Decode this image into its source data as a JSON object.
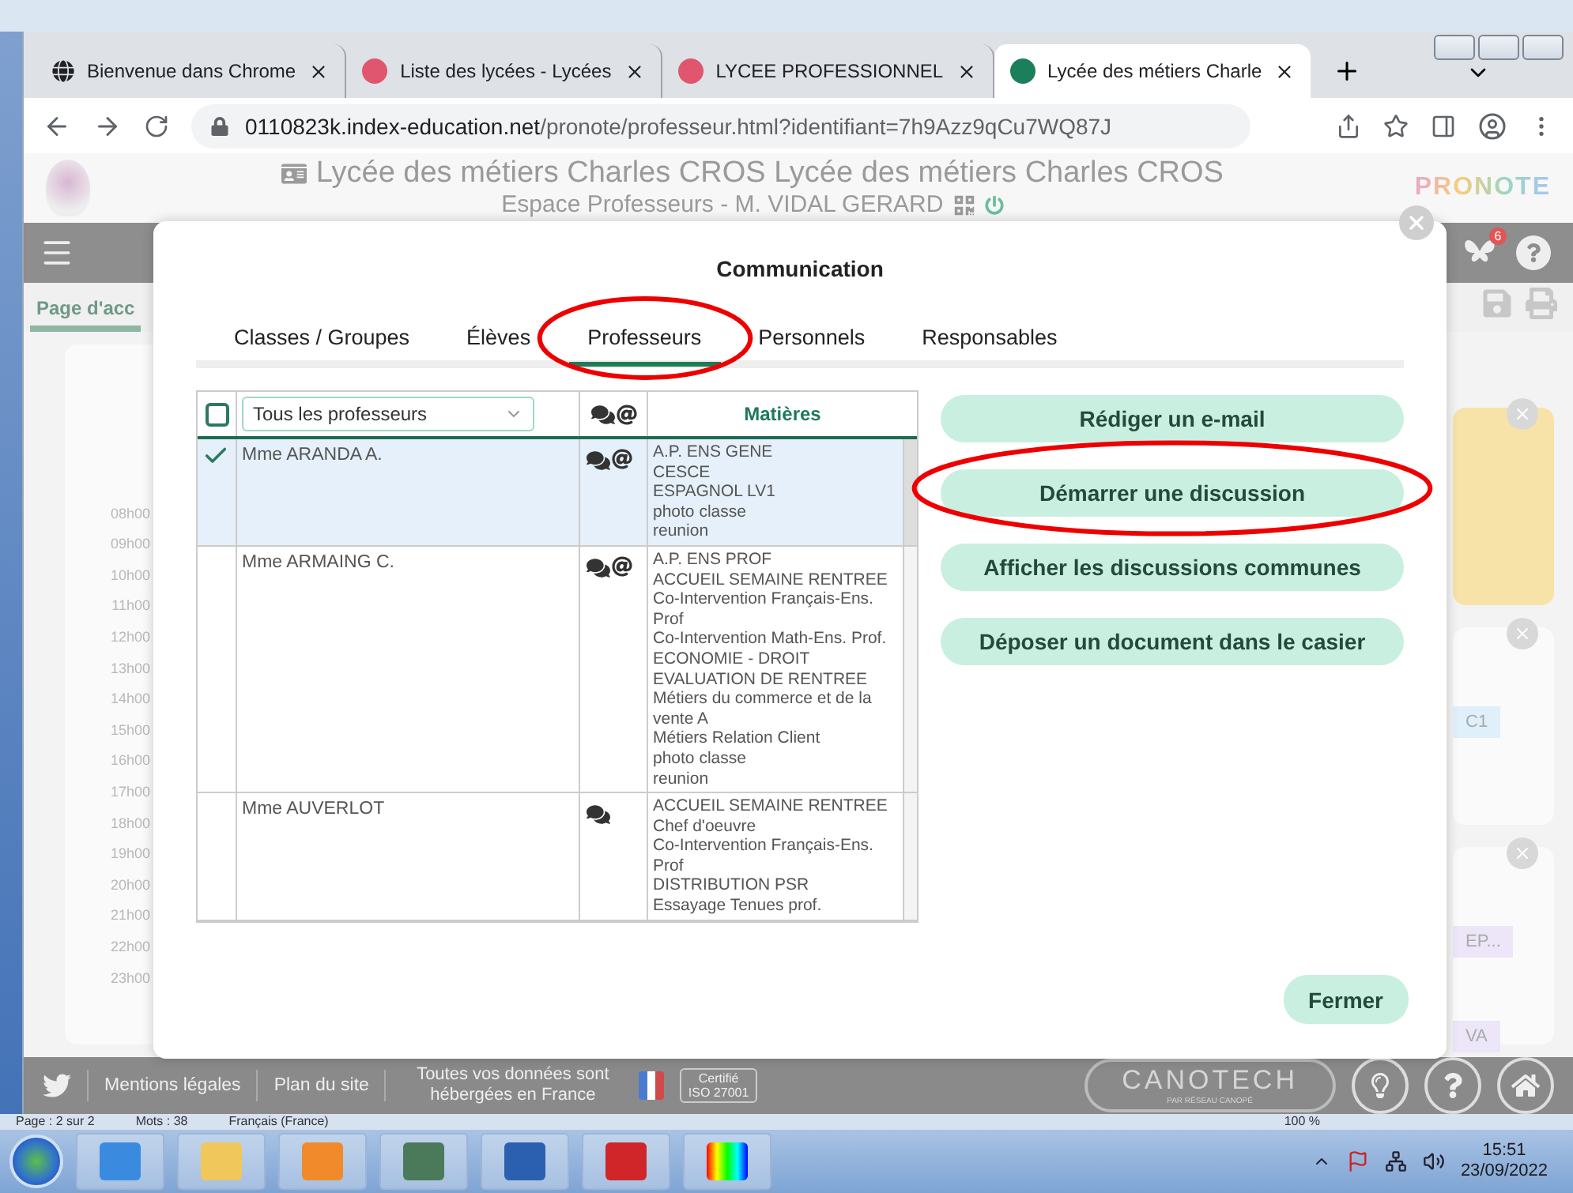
{
  "browser": {
    "tabs": [
      {
        "title": "Bienvenue dans Chrome",
        "selected": false
      },
      {
        "title": "Liste des lycées - Lycées",
        "selected": false
      },
      {
        "title": "LYCEE PROFESSIONNEL",
        "selected": false
      },
      {
        "title": "Lycée des métiers Charle",
        "selected": true
      }
    ],
    "url": {
      "host": "0110823k.index-education.net",
      "path": "/pronote/professeur.html?identifiant=7h9Azz9qCu7WQ87J"
    }
  },
  "header": {
    "title": "Lycée des métiers Charles CROS Lycée des métiers Charles CROS",
    "subtitle": "Espace Professeurs - M. VIDAL GERARD",
    "brand": "PRONOTE",
    "notification_count": "6"
  },
  "page": {
    "tab": "Page d'acc",
    "hours": [
      "08h00",
      "09h00",
      "10h00",
      "11h00",
      "12h00",
      "13h00",
      "14h00",
      "15h00",
      "16h00",
      "17h00",
      "18h00",
      "19h00",
      "20h00",
      "21h00",
      "22h00",
      "23h00"
    ],
    "tags": [
      {
        "text": "C1",
        "color": "#dff0fb"
      },
      {
        "text": "EP...",
        "color": "#ece6f8"
      },
      {
        "text": "VA",
        "color": "#ece6f8"
      }
    ]
  },
  "dialog": {
    "title": "Communication",
    "tabs": [
      {
        "label": "Classes / Groupes",
        "selected": false,
        "circled": false
      },
      {
        "label": "Élèves",
        "selected": false,
        "circled": false
      },
      {
        "label": "Professeurs",
        "selected": true,
        "circled": true
      },
      {
        "label": "Personnels",
        "selected": false,
        "circled": false
      },
      {
        "label": "Responsables",
        "selected": false,
        "circled": false
      }
    ],
    "select_all": {
      "checked": false
    },
    "filter": {
      "value": "Tous les professeurs"
    },
    "subjects_heading": "Matières",
    "rows": [
      {
        "name": "Mme ARANDA A.",
        "checked": true,
        "discussion": true,
        "email": true,
        "subjects": [
          "A.P. ENS GENE",
          "CESCE",
          "ESPAGNOL LV1",
          "photo classe",
          "reunion"
        ]
      },
      {
        "name": "Mme ARMAING C.",
        "checked": false,
        "discussion": true,
        "email": true,
        "subjects": [
          "A.P. ENS PROF",
          "ACCUEIL SEMAINE RENTREE",
          "Co-Intervention Français-Ens. Prof",
          "Co-Intervention Math-Ens. Prof.",
          "ECONOMIE - DROIT",
          "EVALUATION DE RENTREE",
          "Métiers du commerce et de la vente A",
          "Métiers Relation Client",
          "photo classe",
          "reunion"
        ]
      },
      {
        "name": "Mme AUVERLOT",
        "checked": false,
        "discussion": true,
        "email": false,
        "subjects": [
          "ACCUEIL SEMAINE RENTREE",
          "Chef d'oeuvre",
          "Co-Intervention Français-Ens. Prof",
          "DISTRIBUTION PSR",
          "Essayage Tenues prof."
        ]
      }
    ],
    "actions": [
      {
        "label": "Rédiger un e-mail",
        "circled": false
      },
      {
        "label": "Démarrer une discussion",
        "circled": true
      },
      {
        "label": "Afficher les discussions communes",
        "circled": false
      },
      {
        "label": "Déposer un document dans le casier",
        "circled": false
      }
    ],
    "close": "Fermer"
  },
  "footer": {
    "links": [
      "Mentions légales",
      "Plan du site"
    ],
    "hosting_note": "Toutes vos données sont hébergées en France",
    "certification": [
      "Certifié",
      "ISO 27001"
    ],
    "partner": "CANOTECH",
    "partner_tagline": "PAR RÉSEAU CANOPÉ"
  },
  "word_status": {
    "page": "Page : 2 sur 2",
    "words": "Mots : 38",
    "language": "Français (France)",
    "zoom": "100 %"
  },
  "taskbar": {
    "time": "15:51",
    "date": "23/09/2022"
  }
}
